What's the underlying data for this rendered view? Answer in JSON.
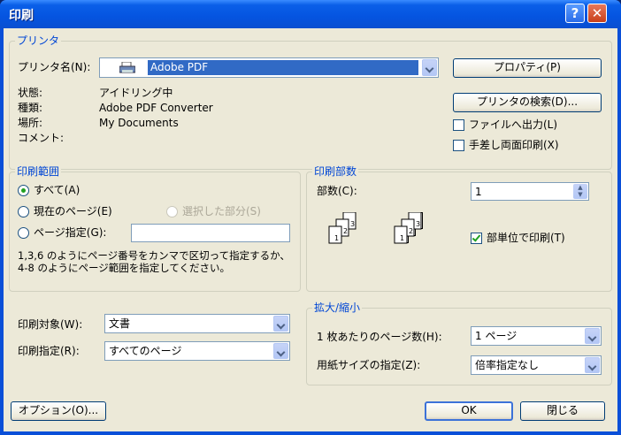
{
  "title": "印刷",
  "titlebar": {
    "help": "?",
    "close": "✕"
  },
  "printer": {
    "group_title": "プリンタ",
    "name_label": "プリンタ名(N):",
    "name_value": "Adobe PDF",
    "properties_button": "プロパティ(P)",
    "find_printer_button": "プリンタの検索(D)...",
    "status_label": "状態:",
    "status_value": "アイドリング中",
    "type_label": "種類:",
    "type_value": "Adobe PDF Converter",
    "where_label": "場所:",
    "where_value": "My Documents",
    "comment_label": "コメント:",
    "print_to_file": "ファイルへ出力(L)",
    "manual_duplex": "手差し両面印刷(X)"
  },
  "range": {
    "group_title": "印刷範囲",
    "all": "すべて(A)",
    "current_page": "現在のページ(E)",
    "selection": "選択した部分(S)",
    "pages": "ページ指定(G):",
    "pages_value": "",
    "hint": "1,3,6 のようにページ番号をカンマで区切って指定するか、4-8 のようにページ範囲を指定してください。"
  },
  "copies": {
    "group_title": "印刷部数",
    "count_label": "部数(C):",
    "count_value": "1",
    "collate": "部単位で印刷(T)"
  },
  "print_what": {
    "label": "印刷対象(W):",
    "value": "文書"
  },
  "print_pages": {
    "label": "印刷指定(R):",
    "value": "すべてのページ"
  },
  "zoom": {
    "group_title": "拡大/縮小",
    "per_sheet_label": "1 枚あたりのページ数(H):",
    "per_sheet_value": "1 ページ",
    "scale_label": "用紙サイズの指定(Z):",
    "scale_value": "倍率指定なし"
  },
  "footer": {
    "options": "オプション(O)...",
    "ok": "OK",
    "close": "閉じる"
  }
}
